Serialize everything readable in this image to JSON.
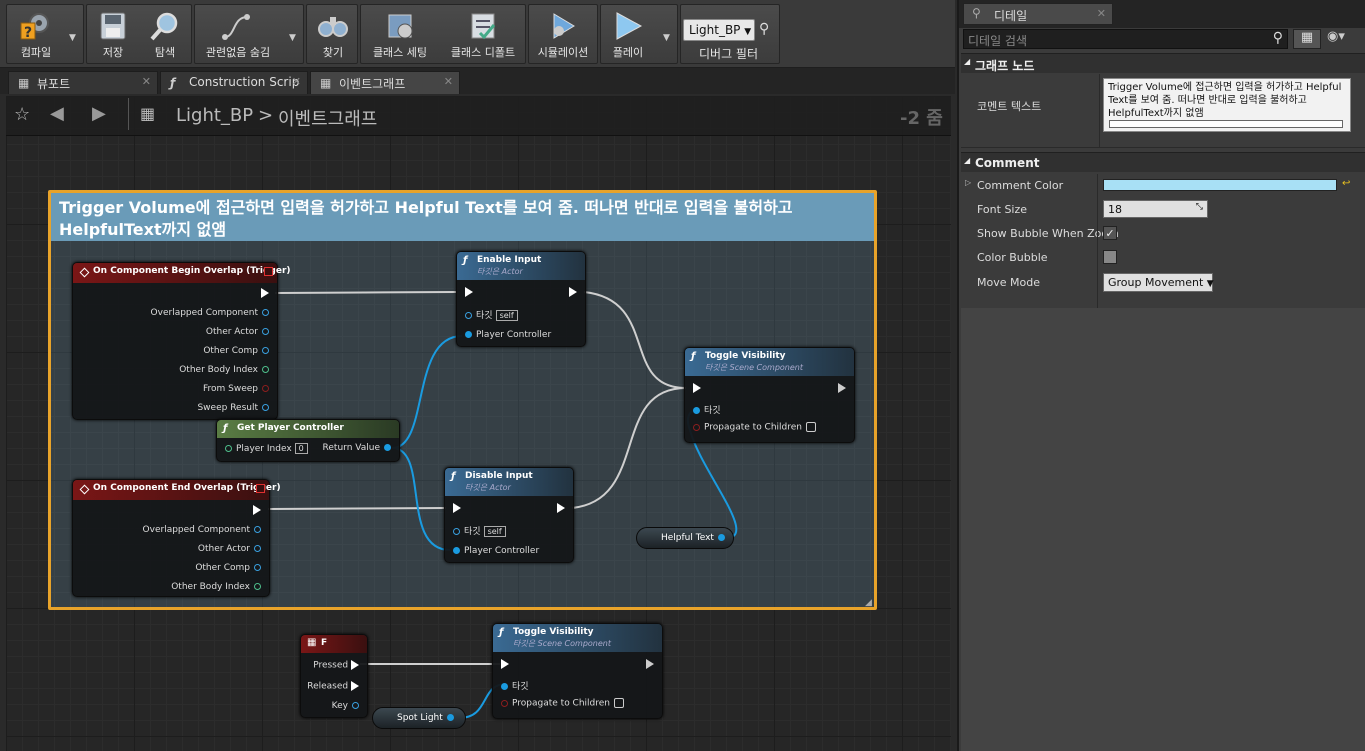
{
  "toolbar": {
    "compile": "컴파일",
    "save": "저장",
    "browse": "탐색",
    "hide_unrelated": "관련없음 숨김",
    "find": "찾기",
    "class_settings": "클래스 세팅",
    "class_defaults": "클래스 디폴트",
    "simulation": "시뮬레이션",
    "play": "플레이",
    "debug_object": "Light_BP",
    "debug_filter": "디버그 필터"
  },
  "tabs": [
    {
      "label": "뷰포트",
      "icon": "viewport-icon"
    },
    {
      "label": "Construction Scrip",
      "icon": "function-icon"
    },
    {
      "label": "이벤트그래프",
      "icon": "graph-icon"
    }
  ],
  "graph_header": {
    "blueprint": "Light_BP",
    "separator": ">",
    "graph": "이벤트그래프",
    "zoom": "-2 줌"
  },
  "comment": {
    "text": "Trigger Volume에 접근하면 입력을 허가하고 Helpful Text를 보여 줌. 떠나면 반대로 입력을 불허하고 HelpfulText까지 없앰",
    "color": "#a8e0f5"
  },
  "nodes": {
    "begin_overlap": {
      "title": "On Component Begin Overlap (Trigger)",
      "pins": [
        "Overlapped Component",
        "Other Actor",
        "Other Comp",
        "Other Body Index",
        "From Sweep",
        "Sweep Result"
      ]
    },
    "end_overlap": {
      "title": "On Component End Overlap (Trigger)",
      "pins": [
        "Overlapped Component",
        "Other Actor",
        "Other Comp",
        "Other Body Index"
      ]
    },
    "get_player_controller": {
      "title": "Get Player Controller",
      "index_label": "Player Index",
      "index_value": "0",
      "return_label": "Return Value"
    },
    "enable_input": {
      "title": "Enable Input",
      "subtitle": "타깃은 Actor",
      "target": "타깃",
      "self": "self",
      "player_controller": "Player Controller"
    },
    "disable_input": {
      "title": "Disable Input",
      "subtitle": "타깃은 Actor",
      "target": "타깃",
      "self": "self",
      "player_controller": "Player Controller"
    },
    "toggle_vis_1": {
      "title": "Toggle Visibility",
      "subtitle": "타깃은 Scene Component",
      "target": "타깃",
      "propagate": "Propagate to Children"
    },
    "toggle_vis_2": {
      "title": "Toggle Visibility",
      "subtitle": "타깃은 Scene Component",
      "target": "타깃",
      "propagate": "Propagate to Children"
    },
    "helpful_text": {
      "label": "Helpful Text"
    },
    "spot_light": {
      "label": "Spot Light"
    },
    "key_f": {
      "title": "F",
      "pressed": "Pressed",
      "released": "Released",
      "key": "Key"
    }
  },
  "details": {
    "tab": "디테일",
    "search_placeholder": "디테일 검색",
    "graph_node_section": "그래프 노드",
    "comment_text_label": "코멘트 텍스트",
    "comment_text_value": "Trigger Volume에 접근하면 입력을 허가하고 Helpful Text를 보여 줌. 떠나면 반대로 입력을 불허하고 HelpfulText까지 없앰",
    "comment_section": "Comment",
    "comment_color_label": "Comment Color",
    "font_size_label": "Font Size",
    "font_size_value": "18",
    "show_bubble_label": "Show Bubble When Zoom",
    "show_bubble_checked": true,
    "color_bubble_label": "Color Bubble",
    "color_bubble_checked": false,
    "move_mode_label": "Move Mode",
    "move_mode_value": "Group Movement"
  }
}
